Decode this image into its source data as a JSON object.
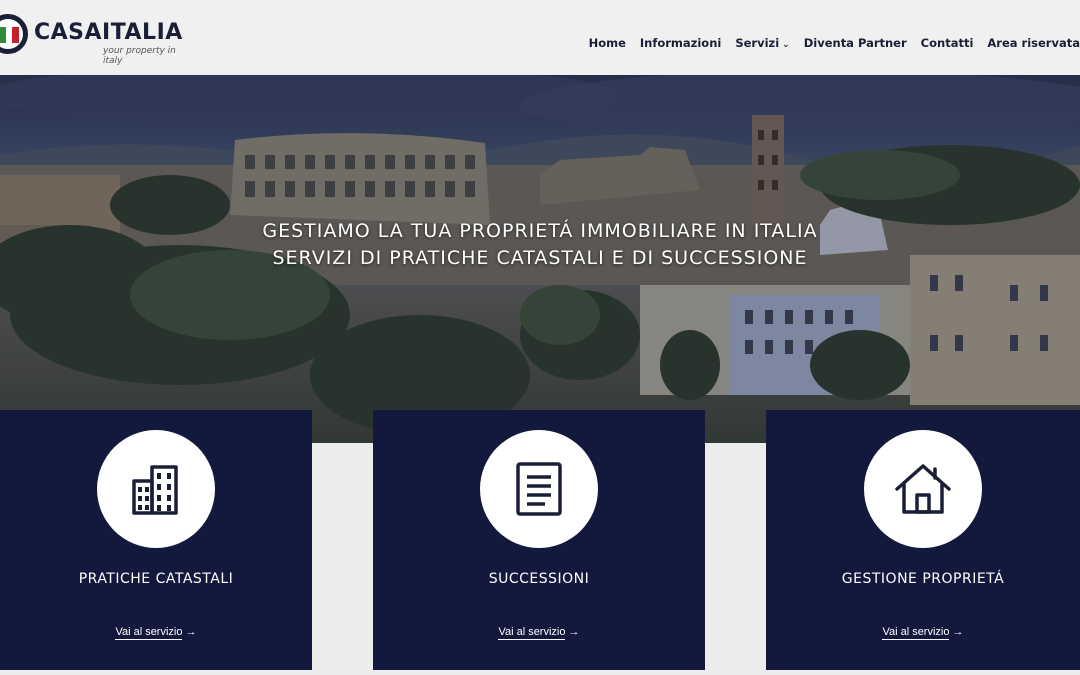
{
  "brand": {
    "name": "CASAITALIA",
    "tagline": "your property in italy",
    "colors": {
      "navy": "#1a1f36",
      "card": "#12193d",
      "green": "#2e8b3a",
      "red": "#c8202a"
    }
  },
  "nav": {
    "items": [
      {
        "label": "Home"
      },
      {
        "label": "Informazioni"
      },
      {
        "label": "Servizi",
        "caret": "⌄"
      },
      {
        "label": "Diventa Partner"
      },
      {
        "label": "Contatti"
      },
      {
        "label": "Area riservata"
      }
    ]
  },
  "hero": {
    "line1": "GESTIAMO LA TUA PROPRIETÁ IMMOBILIARE IN ITALIA",
    "line2": "SERVIZI DI PRATICHE CATASTALI E DI SUCCESSIONE"
  },
  "cards": [
    {
      "title": "PRATICHE CATASTALI",
      "link": "Vai al servizio",
      "arrow": "→",
      "icon": "building-icon"
    },
    {
      "title": "SUCCESSIONI",
      "link": "Vai al servizio",
      "arrow": "→",
      "icon": "document-icon"
    },
    {
      "title": "GESTIONE PROPRIETÁ",
      "link": "Vai al servizio",
      "arrow": "→",
      "icon": "house-icon"
    }
  ]
}
